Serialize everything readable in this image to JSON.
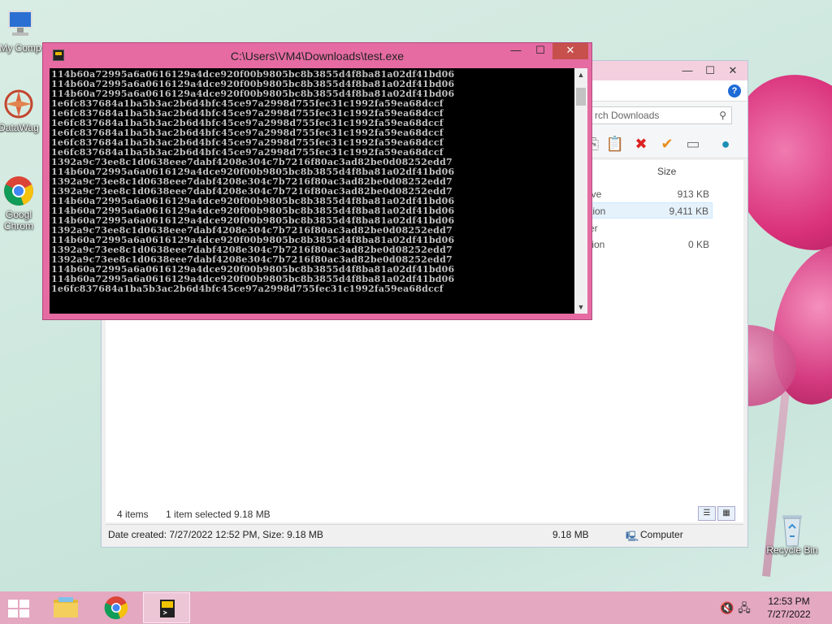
{
  "desktop": {
    "icons": [
      {
        "label": "My Comp"
      },
      {
        "label": "DataWag"
      },
      {
        "label": "Googl\nChrom"
      },
      {
        "label": "Recycle Bin"
      }
    ]
  },
  "explorer": {
    "search_placeholder": "rch Downloads",
    "column_size": "Size",
    "rows": [
      {
        "name": "ive",
        "size": "913 KB"
      },
      {
        "name": "tion",
        "size": "9,411 KB"
      },
      {
        "name": "er",
        "size": ""
      },
      {
        "name": "tion",
        "size": "0 KB"
      }
    ],
    "status": {
      "items": "4 items",
      "selected": "1 item selected",
      "selected_size": "9.18 MB"
    },
    "details": {
      "created": "Date created: 7/27/2022 12:52 PM, Size: 9.18 MB",
      "size": "9.18 MB",
      "location": "Computer"
    }
  },
  "console": {
    "title": "C:\\Users\\VM4\\Downloads\\test.exe",
    "lines": [
      "114b60a72995a6a0616129a4dce920f00b9805bc8b3855d4f8ba81a02df41bd06",
      "114b60a72995a6a0616129a4dce920f00b9805bc8b3855d4f8ba81a02df41bd06",
      "114b60a72995a6a0616129a4dce920f00b9805bc8b3855d4f8ba81a02df41bd06",
      "1e6fc837684a1ba5b3ac2b6d4bfc45ce97a2998d755fec31c1992fa59ea68dccf",
      "1e6fc837684a1ba5b3ac2b6d4bfc45ce97a2998d755fec31c1992fa59ea68dccf",
      "1e6fc837684a1ba5b3ac2b6d4bfc45ce97a2998d755fec31c1992fa59ea68dccf",
      "1e6fc837684a1ba5b3ac2b6d4bfc45ce97a2998d755fec31c1992fa59ea68dccf",
      "1e6fc837684a1ba5b3ac2b6d4bfc45ce97a2998d755fec31c1992fa59ea68dccf",
      "1e6fc837684a1ba5b3ac2b6d4bfc45ce97a2998d755fec31c1992fa59ea68dccf",
      "1392a9c73ee8c1d0638eee7dabf4208e304c7b7216f80ac3ad82be0d08252edd7",
      "114b60a72995a6a0616129a4dce920f00b9805bc8b3855d4f8ba81a02df41bd06",
      "1392a9c73ee8c1d0638eee7dabf4208e304c7b7216f80ac3ad82be0d08252edd7",
      "1392a9c73ee8c1d0638eee7dabf4208e304c7b7216f80ac3ad82be0d08252edd7",
      "114b60a72995a6a0616129a4dce920f00b9805bc8b3855d4f8ba81a02df41bd06",
      "114b60a72995a6a0616129a4dce920f00b9805bc8b3855d4f8ba81a02df41bd06",
      "114b60a72995a6a0616129a4dce920f00b9805bc8b3855d4f8ba81a02df41bd06",
      "1392a9c73ee8c1d0638eee7dabf4208e304c7b7216f80ac3ad82be0d08252edd7",
      "114b60a72995a6a0616129a4dce920f00b9805bc8b3855d4f8ba81a02df41bd06",
      "1392a9c73ee8c1d0638eee7dabf4208e304c7b7216f80ac3ad82be0d08252edd7",
      "1392a9c73ee8c1d0638eee7dabf4208e304c7b7216f80ac3ad82be0d08252edd7",
      "114b60a72995a6a0616129a4dce920f00b9805bc8b3855d4f8ba81a02df41bd06",
      "114b60a72995a6a0616129a4dce920f00b9805bc8b3855d4f8ba81a02df41bd06",
      "1e6fc837684a1ba5b3ac2b6d4bfc45ce97a2998d755fec31c1992fa59ea68dccf"
    ]
  },
  "taskbar": {
    "time": "12:53 PM",
    "date": "7/27/2022"
  }
}
